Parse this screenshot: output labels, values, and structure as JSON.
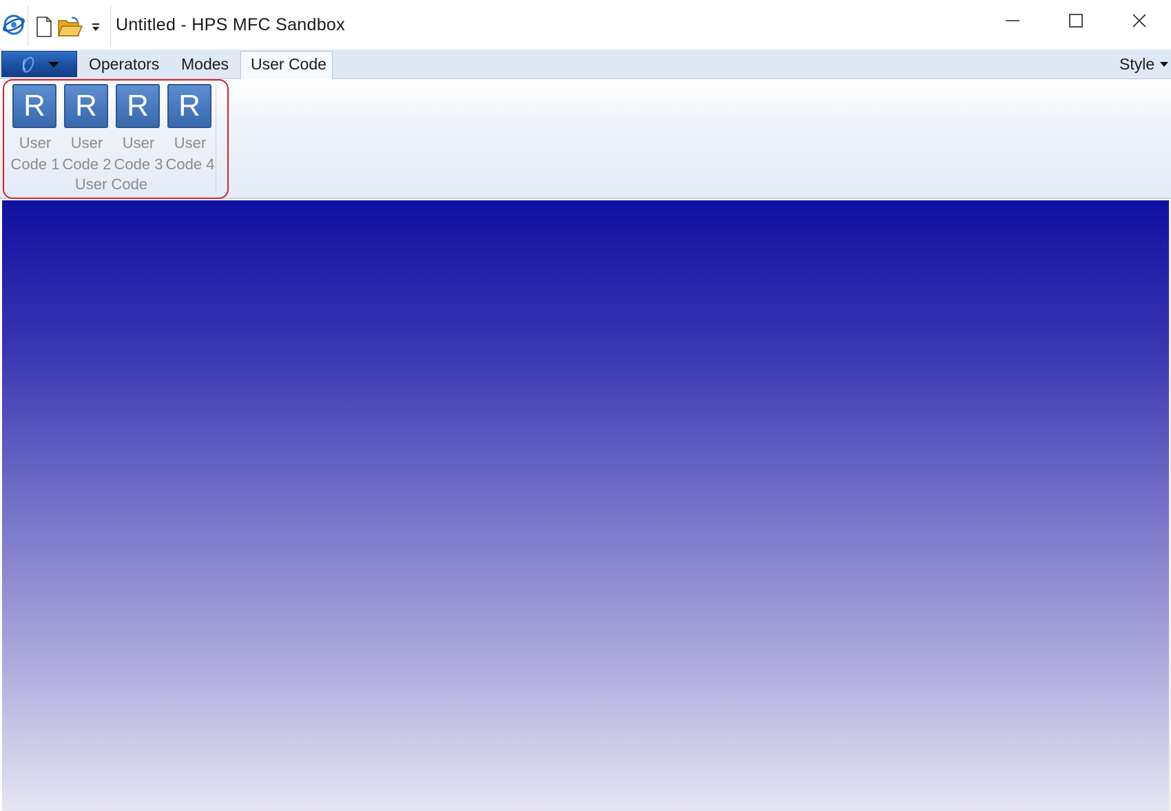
{
  "window": {
    "title": "Untitled - HPS MFC Sandbox"
  },
  "quick_access": {
    "icons": [
      "new-document-icon",
      "open-folder-icon",
      "customize-icon"
    ]
  },
  "ribbon": {
    "tabs": [
      {
        "label": "Operators"
      },
      {
        "label": "Modes"
      },
      {
        "label": "User Code",
        "active": true
      }
    ],
    "style_menu": "Style",
    "group": {
      "label": "User Code",
      "buttons": [
        {
          "icon_glyph": "R",
          "line1": "User",
          "line2": "Code 1"
        },
        {
          "icon_glyph": "R",
          "line1": "User",
          "line2": "Code 2"
        },
        {
          "icon_glyph": "R",
          "line1": "User",
          "line2": "Code 3"
        },
        {
          "icon_glyph": "R",
          "line1": "User",
          "line2": "Code 4"
        }
      ]
    }
  },
  "colors": {
    "highlight": "#d8202a",
    "icon_blue": "#4577bd",
    "viewport_top": "#0f10a0",
    "viewport_bottom": "#e6e5f2"
  }
}
